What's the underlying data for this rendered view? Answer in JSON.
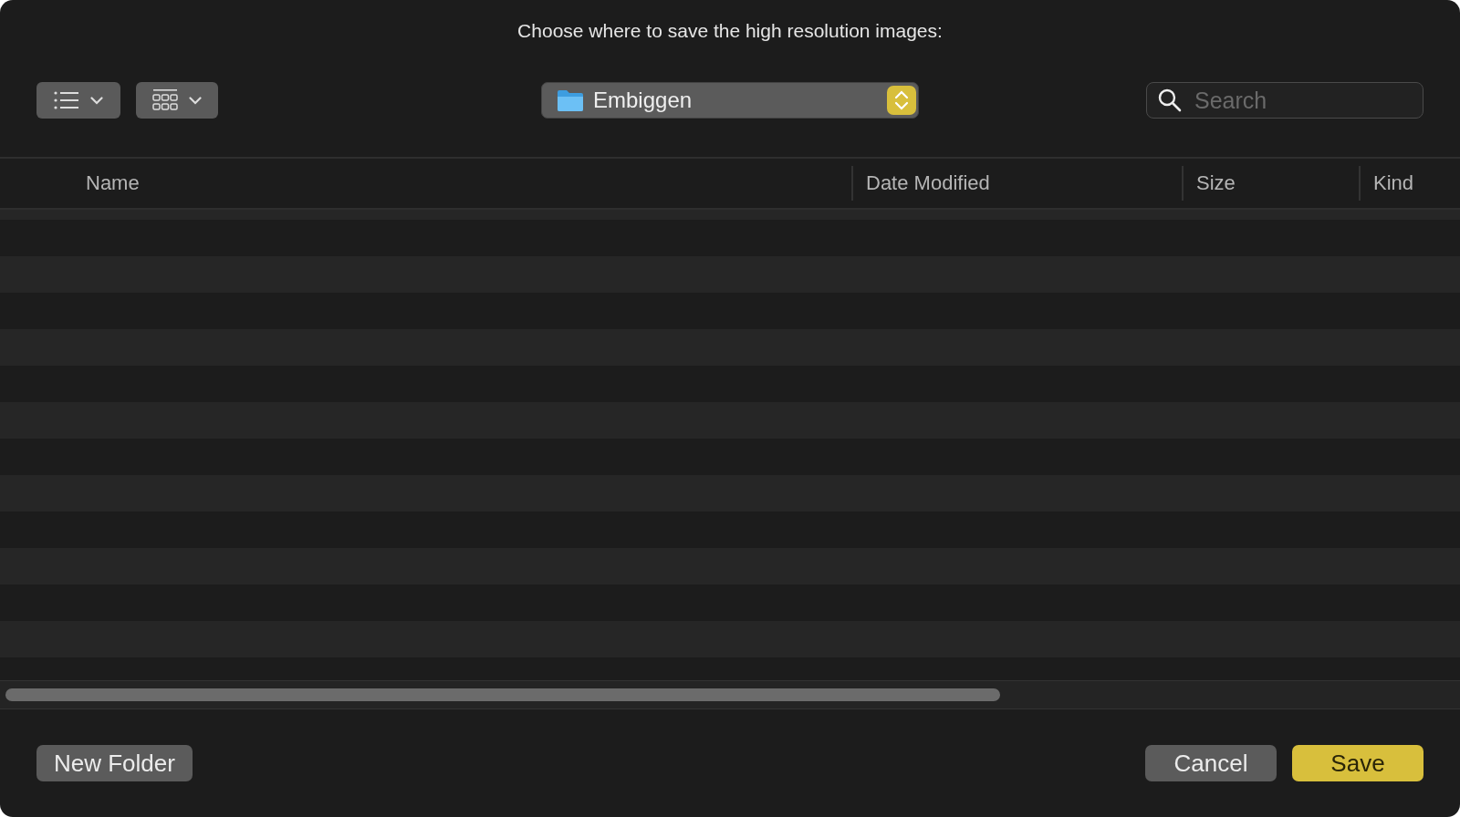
{
  "dialog": {
    "title": "Choose where to save the high resolution images:"
  },
  "toolbar": {
    "location": "Embiggen",
    "search": {
      "placeholder": "Search"
    }
  },
  "table": {
    "columns": [
      {
        "label": "Name"
      },
      {
        "label": "Date Modified"
      },
      {
        "label": "Size"
      },
      {
        "label": "Kind"
      }
    ]
  },
  "footer": {
    "new_folder": "New Folder",
    "buttons": [
      {
        "label": "Cancel",
        "kind": "secondary"
      },
      {
        "label": "Save",
        "kind": "primary"
      }
    ]
  }
}
